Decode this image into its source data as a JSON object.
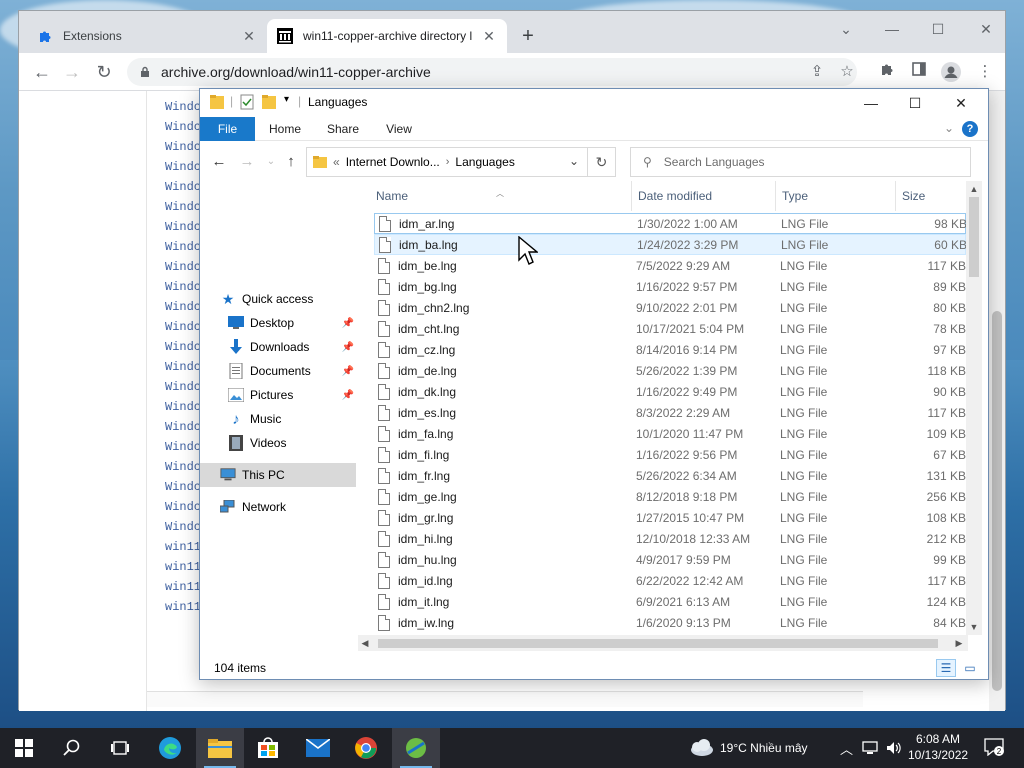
{
  "browser": {
    "tabs": [
      {
        "title": "Extensions",
        "close": "✕"
      },
      {
        "title": "win11-copper-archive directory l",
        "close": "✕"
      }
    ],
    "new_tab": "+",
    "url": "archive.org/download/win11-copper-archive"
  },
  "page": {
    "listing": [
      "Windc",
      "Windc",
      "Windc",
      "Windc",
      "Windc",
      "Windc",
      "Windc",
      "Windc",
      "Windc",
      "Windc",
      "Windc",
      "Windc",
      "Windc",
      "Windc",
      "Windc",
      "Windc",
      "Windc",
      "Windc",
      "Windc",
      "Windc",
      "Windc",
      "Windc",
      "win11",
      "win11",
      "win11",
      "win11"
    ]
  },
  "explorer": {
    "title": "Languages",
    "ribbon_tabs": [
      "File",
      "Home",
      "Share",
      "View"
    ],
    "breadcrumb": {
      "prefix": "«",
      "parent": "Internet Downlo...",
      "sep": "›",
      "current": "Languages"
    },
    "search_placeholder": "Search Languages",
    "nav": {
      "quick_access": "Quick access",
      "items": [
        "Desktop",
        "Downloads",
        "Documents",
        "Pictures",
        "Music",
        "Videos"
      ],
      "this_pc": "This PC",
      "network": "Network"
    },
    "columns": [
      "Name",
      "Date modified",
      "Type",
      "Size"
    ],
    "files": [
      {
        "name": "idm_ar.lng",
        "date": "1/30/2022 1:00 AM",
        "type": "LNG File",
        "size": "98 KB"
      },
      {
        "name": "idm_ba.lng",
        "date": "1/24/2022 3:29 PM",
        "type": "LNG File",
        "size": "60 KB"
      },
      {
        "name": "idm_be.lng",
        "date": "7/5/2022 9:29 AM",
        "type": "LNG File",
        "size": "117 KB"
      },
      {
        "name": "idm_bg.lng",
        "date": "1/16/2022 9:57 PM",
        "type": "LNG File",
        "size": "89 KB"
      },
      {
        "name": "idm_chn2.lng",
        "date": "9/10/2022 2:01 PM",
        "type": "LNG File",
        "size": "80 KB"
      },
      {
        "name": "idm_cht.lng",
        "date": "10/17/2021 5:04 PM",
        "type": "LNG File",
        "size": "78 KB"
      },
      {
        "name": "idm_cz.lng",
        "date": "8/14/2016 9:14 PM",
        "type": "LNG File",
        "size": "97 KB"
      },
      {
        "name": "idm_de.lng",
        "date": "5/26/2022 1:39 PM",
        "type": "LNG File",
        "size": "118 KB"
      },
      {
        "name": "idm_dk.lng",
        "date": "1/16/2022 9:49 PM",
        "type": "LNG File",
        "size": "90 KB"
      },
      {
        "name": "idm_es.lng",
        "date": "8/3/2022 2:29 AM",
        "type": "LNG File",
        "size": "117 KB"
      },
      {
        "name": "idm_fa.lng",
        "date": "10/1/2020 11:47 PM",
        "type": "LNG File",
        "size": "109 KB"
      },
      {
        "name": "idm_fi.lng",
        "date": "1/16/2022 9:56 PM",
        "type": "LNG File",
        "size": "67 KB"
      },
      {
        "name": "idm_fr.lng",
        "date": "5/26/2022 6:34 AM",
        "type": "LNG File",
        "size": "131 KB"
      },
      {
        "name": "idm_ge.lng",
        "date": "8/12/2018 9:18 PM",
        "type": "LNG File",
        "size": "256 KB"
      },
      {
        "name": "idm_gr.lng",
        "date": "1/27/2015 10:47 PM",
        "type": "LNG File",
        "size": "108 KB"
      },
      {
        "name": "idm_hi.lng",
        "date": "12/10/2018 12:33 AM",
        "type": "LNG File",
        "size": "212 KB"
      },
      {
        "name": "idm_hu.lng",
        "date": "4/9/2017 9:59 PM",
        "type": "LNG File",
        "size": "99 KB"
      },
      {
        "name": "idm_id.lng",
        "date": "6/22/2022 12:42 AM",
        "type": "LNG File",
        "size": "117 KB"
      },
      {
        "name": "idm_it.lng",
        "date": "6/9/2021 6:13 AM",
        "type": "LNG File",
        "size": "124 KB"
      },
      {
        "name": "idm_iw.lng",
        "date": "1/6/2020 9:13 PM",
        "type": "LNG File",
        "size": "84 KB"
      }
    ],
    "status_count": "104 items"
  },
  "taskbar": {
    "weather": "19°C  Nhiều mây",
    "time": "6:08 AM",
    "date": "10/13/2022"
  },
  "colors": {
    "accent": "#1979ca",
    "hover_row": "#e5f3ff",
    "taskbar": "#1f2127"
  }
}
